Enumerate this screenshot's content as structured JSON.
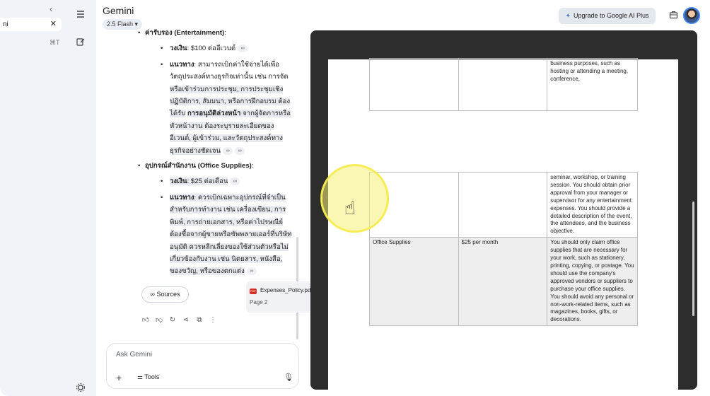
{
  "sidebar": {
    "collapse_icon": "‹",
    "search_text": "ni",
    "close_icon": "✕",
    "shortcut": "⌘T"
  },
  "header": {
    "title": "Gemini",
    "model": "2.5 Flash",
    "upgrade_label": "Upgrade to Google AI Plus"
  },
  "chat": {
    "entertainment_heading_plain": "ค่ารับรอง ",
    "entertainment_heading_paren": "(Entertainment)",
    "entertainment_amount_label": "วงเงิน",
    "entertainment_amount": ": $100 ต่ออีเวนต์",
    "entertainment_guide_label": "แนวทาง",
    "entertainment_guide_lines": [
      ": สามารถเบิกค่าใช้จ่ายได้เพื่อ",
      "วัตถุประสงค์ทางธุรกิจเท่านั้น เช่น การจัด",
      "หรือเข้าร่วมการประชุม, การประชุมเชิง",
      "ปฏิบัติการ, สัมมนา, หรือการฝึกอบรม ต้อง",
      "ได้รับ",
      "การอนุมัติล่วงหน้า",
      " จากผู้จัดการหรือ",
      "หัวหน้างาน ต้องระบุรายละเอียดของ",
      "อีเวนต์, ผู้เข้าร่วม, และวัตถุประสงค์ทาง",
      "ธุรกิจอย่างชัดเจน"
    ],
    "office_heading_plain": "อุปกรณ์สำนักงาน ",
    "office_heading_paren": "(Office Supplies)",
    "office_amount_label": "วงเงิน",
    "office_amount": ": $25 ต่อเดือน",
    "office_guide_label": "แนวทาง",
    "office_guide_lines": [
      ": ควรเบิกเฉพาะอุปกรณ์ที่จำเป็น",
      "สำหรับการทำงาน เช่น เครื่องเขียน, การ",
      "พิมพ์, การถ่ายเอกสาร, หรือค่าไปรษณีย์",
      "ต้องซื้อจากผู้ขายหรือซัพพลายเออร์ที่บริษัท",
      "อนุมัติ ควรหลีกเลี่ยงของใช้ส่วนตัวหรือไม่",
      "เกี่ยวข้องกับงาน เช่น นิตยสาร, หนังสือ,",
      "ของขวัญ, หรือของตกแต่ง"
    ],
    "sources_label": "Sources",
    "file_name": "Expenses_Policy.pdf",
    "file_page": "Page 2",
    "input_placeholder": "Ask Gemini",
    "tools_label": "Tools"
  },
  "pdf": {
    "page_a_row": {
      "col1": "",
      "col2": "",
      "col3": "business purposes, such as hosting or attending a meeting, conference,"
    },
    "page_b_rows": [
      {
        "col1": "",
        "col2": "",
        "col3": "seminar, workshop, or training session. You should obtain prior approval from your manager or supervisor for any entertainment expenses. You should provide a detailed description of the event, the attendees, and the business objective."
      },
      {
        "col1": "Office Supplies",
        "col2": "$25 per month",
        "col3": "You should only claim office supplies that are necessary for your work, such as stationery, printing, copying, or postage. You should use the company's approved vendors or suppliers to purchase your office supplies. You should avoid any personal or non-work-related items, such as magazines, books, gifts, or decorations."
      }
    ]
  },
  "colors": {
    "accent": "#4285f4",
    "cursor_highlight": "#f6f078",
    "pdf_backdrop": "#2d2d2d"
  }
}
